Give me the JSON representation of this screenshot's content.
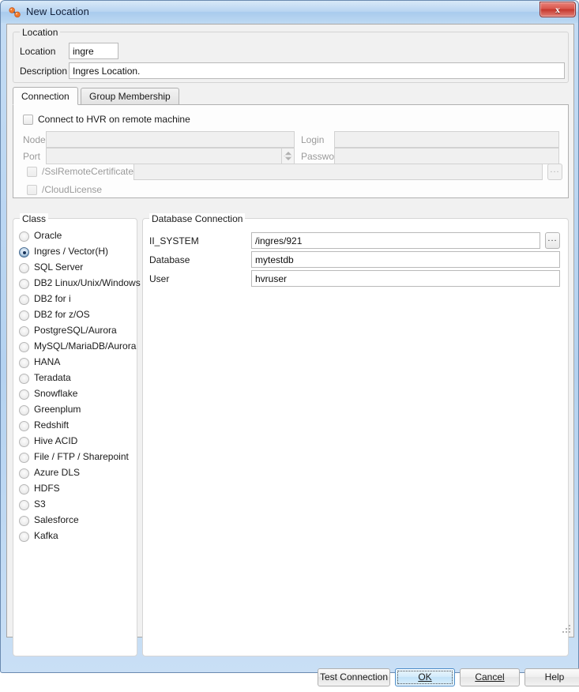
{
  "window": {
    "title": "New Location",
    "icon": "hvr-location-icon",
    "close_label": "x"
  },
  "location_group": {
    "legend": "Location",
    "fields": [
      {
        "label": "Location",
        "value": "ingre",
        "placeholder": ""
      },
      {
        "label": "Description",
        "value": "Ingres Location.",
        "placeholder": ""
      }
    ]
  },
  "tabs": [
    {
      "label": "Connection",
      "active": true
    },
    {
      "label": "Group Membership",
      "active": false
    }
  ],
  "connection_pane": {
    "remote_checkbox": {
      "label": "Connect to HVR on remote machine",
      "checked": false
    },
    "node": {
      "label": "Node",
      "value": "",
      "enabled": false
    },
    "login": {
      "label": "Login",
      "value": "",
      "enabled": false
    },
    "port": {
      "label": "Port",
      "value": "",
      "enabled": false
    },
    "password": {
      "label": "Password",
      "value": "",
      "enabled": false
    },
    "ssl_remote_certificate": {
      "label": "/SslRemoteCertificate",
      "checked": false,
      "value": "",
      "browse": "..."
    },
    "cloud_license": {
      "label": "/CloudLicense",
      "checked": false
    }
  },
  "class_group": {
    "legend": "Class",
    "selected": "Ingres / Vector(H)",
    "items": [
      "Oracle",
      "Ingres / Vector(H)",
      "SQL Server",
      "DB2 Linux/Unix/Windows",
      "DB2 for i",
      "DB2 for z/OS",
      "PostgreSQL/Aurora",
      "MySQL/MariaDB/Aurora",
      "HANA",
      "Teradata",
      "Snowflake",
      "Greenplum",
      "Redshift",
      "Hive ACID",
      "File / FTP / Sharepoint",
      "Azure DLS",
      "HDFS",
      "S3",
      "Salesforce",
      "Kafka"
    ]
  },
  "database_group": {
    "legend": "Database Connection",
    "fields": [
      {
        "label": "II_SYSTEM",
        "value": "/ingres/921",
        "browse": "..."
      },
      {
        "label": "Database",
        "value": "mytestdb"
      },
      {
        "label": "User",
        "value": "hvruser"
      }
    ]
  },
  "footer": {
    "buttons": [
      {
        "label": "Test Connection",
        "mnemonic": "",
        "default": false
      },
      {
        "label": "OK",
        "mnemonic": "O",
        "default": true
      },
      {
        "label": "Cancel",
        "mnemonic": "C",
        "default": false
      },
      {
        "label": "Help",
        "mnemonic": "",
        "default": false
      }
    ]
  },
  "colors": {
    "title_bar": "#a9cbed",
    "accent_selected_radio": "#17335a",
    "default_button_border": "#4d8dc9",
    "close_button": "#c5372c"
  }
}
